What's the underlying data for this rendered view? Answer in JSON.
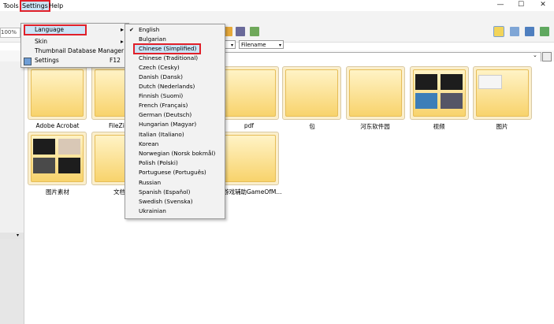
{
  "window": {
    "minimize": "—",
    "maximize": "☐",
    "close": "✕"
  },
  "menubar": {
    "tools": "Tools",
    "settings": "Settings",
    "help": "Help"
  },
  "toolbar": {
    "zoom": "100%",
    "filter_value": "Filename"
  },
  "settings_menu": {
    "items": [
      {
        "label": "Language",
        "arrow": "▸",
        "shortcut": ""
      },
      {
        "label": "Skin",
        "arrow": "▸",
        "shortcut": ""
      },
      {
        "label": "Thumbnail Database Manager",
        "arrow": "",
        "shortcut": ""
      },
      {
        "label": "Settings",
        "arrow": "",
        "shortcut": "F12"
      }
    ]
  },
  "language_menu": {
    "check": "✔",
    "items": [
      "English",
      "Bulgarian",
      "Chinese (Simplified)",
      "Chinese (Traditional)",
      "Czech (Cesky)",
      "Danish (Dansk)",
      "Dutch (Nederlands)",
      "Finnish (Suomi)",
      "French (Français)",
      "German (Deutsch)",
      "Hungarian (Magyar)",
      "Italian (Italiano)",
      "Korean",
      "Norwegian (Norsk bokmål)",
      "Polish (Polski)",
      "Portuguese (Português)",
      "Russian",
      "Spanish (Español)",
      "Swedish (Svenska)",
      "Ukrainian"
    ]
  },
  "folders": {
    "row1": [
      "Adobe Acrobat",
      "FileZil",
      "pdf",
      "包",
      "河东软件园",
      "视频",
      "图片"
    ],
    "row2": [
      "图片素材",
      "文档",
      "游戏辅助GameOfM..."
    ]
  },
  "colors": {
    "highlight": "#e0202a",
    "menu_selected": "#cce4f7",
    "folder": "#f8d36c"
  }
}
